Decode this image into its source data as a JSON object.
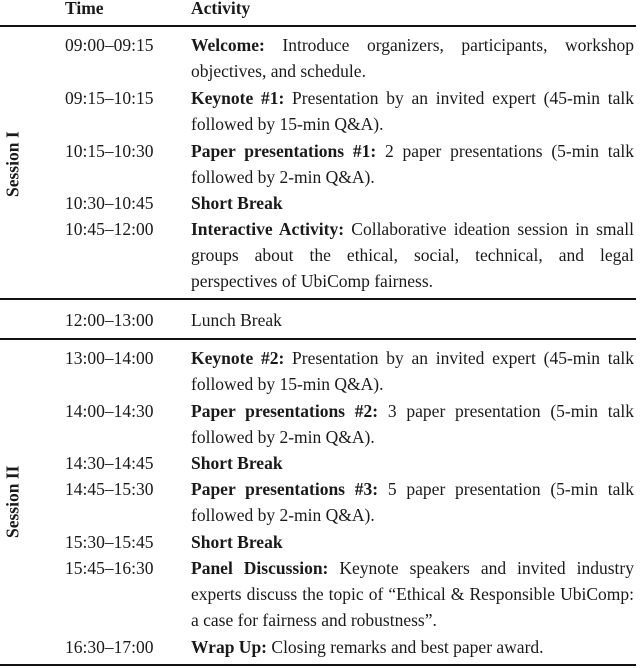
{
  "table": {
    "headers": {
      "time": "Time",
      "activity": "Activity"
    },
    "sessions": [
      {
        "label": "Session I",
        "rows": [
          {
            "time": "09:00–09:15",
            "title": "Welcome:",
            "text": " Introduce organizers, participants, workshop objectives, and schedule."
          },
          {
            "time": "09:15–10:15",
            "title": "Keynote #1:",
            "text": " Presentation by an invited expert (45-min talk followed by 15-min Q&A)."
          },
          {
            "time": "10:15–10:30",
            "title": "Paper presentations #1:",
            "text": " 2 paper presentations (5-min talk followed by 2-min Q&A)."
          },
          {
            "time": "10:30–10:45",
            "title": "Short Break",
            "text": ""
          },
          {
            "time": "10:45–12:00",
            "title": "Interactive Activity:",
            "text": " Collaborative ideation session in small groups about the ethical, social, technical, and legal perspectives of UbiComp fairness."
          }
        ]
      },
      {
        "label": "",
        "rows": [
          {
            "time": "12:00–13:00",
            "title": "",
            "text": "Lunch Break"
          }
        ]
      },
      {
        "label": "Session II",
        "rows": [
          {
            "time": "13:00–14:00",
            "title": "Keynote #2:",
            "text": " Presentation by an invited expert (45-min talk followed by 15-min Q&A)."
          },
          {
            "time": "14:00–14:30",
            "title": "Paper presentations #2:",
            "text": " 3 paper presentation (5-min talk followed by 2-min Q&A)."
          },
          {
            "time": "14:30–14:45",
            "title": "Short Break",
            "text": ""
          },
          {
            "time": "14:45–15:30",
            "title": "Paper presentations #3:",
            "text": " 5 paper presentation (5-min talk followed by 2-min Q&A)."
          },
          {
            "time": "15:30–15:45",
            "title": "Short Break",
            "text": ""
          },
          {
            "time": "15:45–16:30",
            "title": "Panel Discussion:",
            "text": " Keynote speakers and invited industry experts discuss the topic of “Ethical & Responsible UbiComp: a case for fairness and robustness”."
          },
          {
            "time": "16:30–17:00",
            "title": "Wrap Up:",
            "text": " Closing remarks and best paper award."
          }
        ]
      }
    ]
  }
}
